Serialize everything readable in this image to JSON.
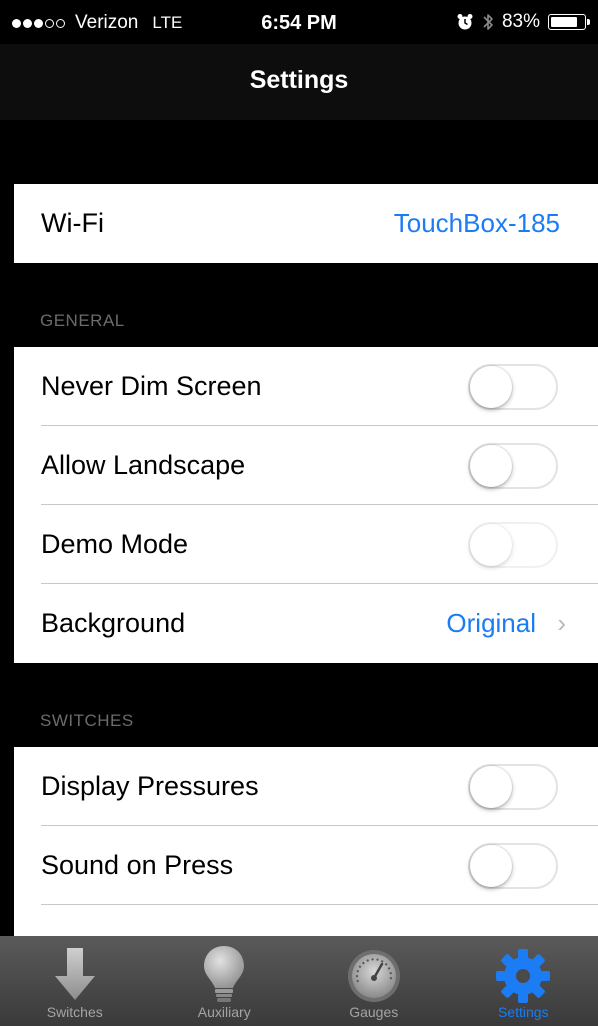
{
  "status_bar": {
    "carrier": "Verizon",
    "network": "LTE",
    "time": "6:54 PM",
    "battery": "83%",
    "battery_level": 0.83,
    "signal_bars_filled": 3,
    "signal_bars_total": 5
  },
  "nav": {
    "title": "Settings"
  },
  "wifi": {
    "label": "Wi-Fi",
    "value": "TouchBox-185"
  },
  "general": {
    "header": "GENERAL",
    "items": [
      {
        "label": "Never Dim Screen",
        "type": "toggle",
        "on": false
      },
      {
        "label": "Allow Landscape",
        "type": "toggle",
        "on": false
      },
      {
        "label": "Demo Mode",
        "type": "toggle",
        "on": false
      },
      {
        "label": "Background",
        "type": "disclosure",
        "value": "Original"
      }
    ]
  },
  "switches": {
    "header": "SWITCHES",
    "items": [
      {
        "label": "Display Pressures",
        "type": "toggle",
        "on": false
      },
      {
        "label": "Sound on Press",
        "type": "toggle",
        "on": false
      }
    ]
  },
  "tabs": [
    {
      "label": "Switches",
      "icon": "down-arrow-icon",
      "active": false
    },
    {
      "label": "Auxiliary",
      "icon": "light-bulb-icon",
      "active": false
    },
    {
      "label": "Gauges",
      "icon": "gauge-icon",
      "active": false
    },
    {
      "label": "Settings",
      "icon": "gear-icon",
      "active": true
    }
  ],
  "colors": {
    "accent": "#1c7cf3",
    "background": "#000000",
    "cell": "#ffffff",
    "section_header_text": "#6b6b6b",
    "tab_label_inactive": "#a4a4a4"
  }
}
